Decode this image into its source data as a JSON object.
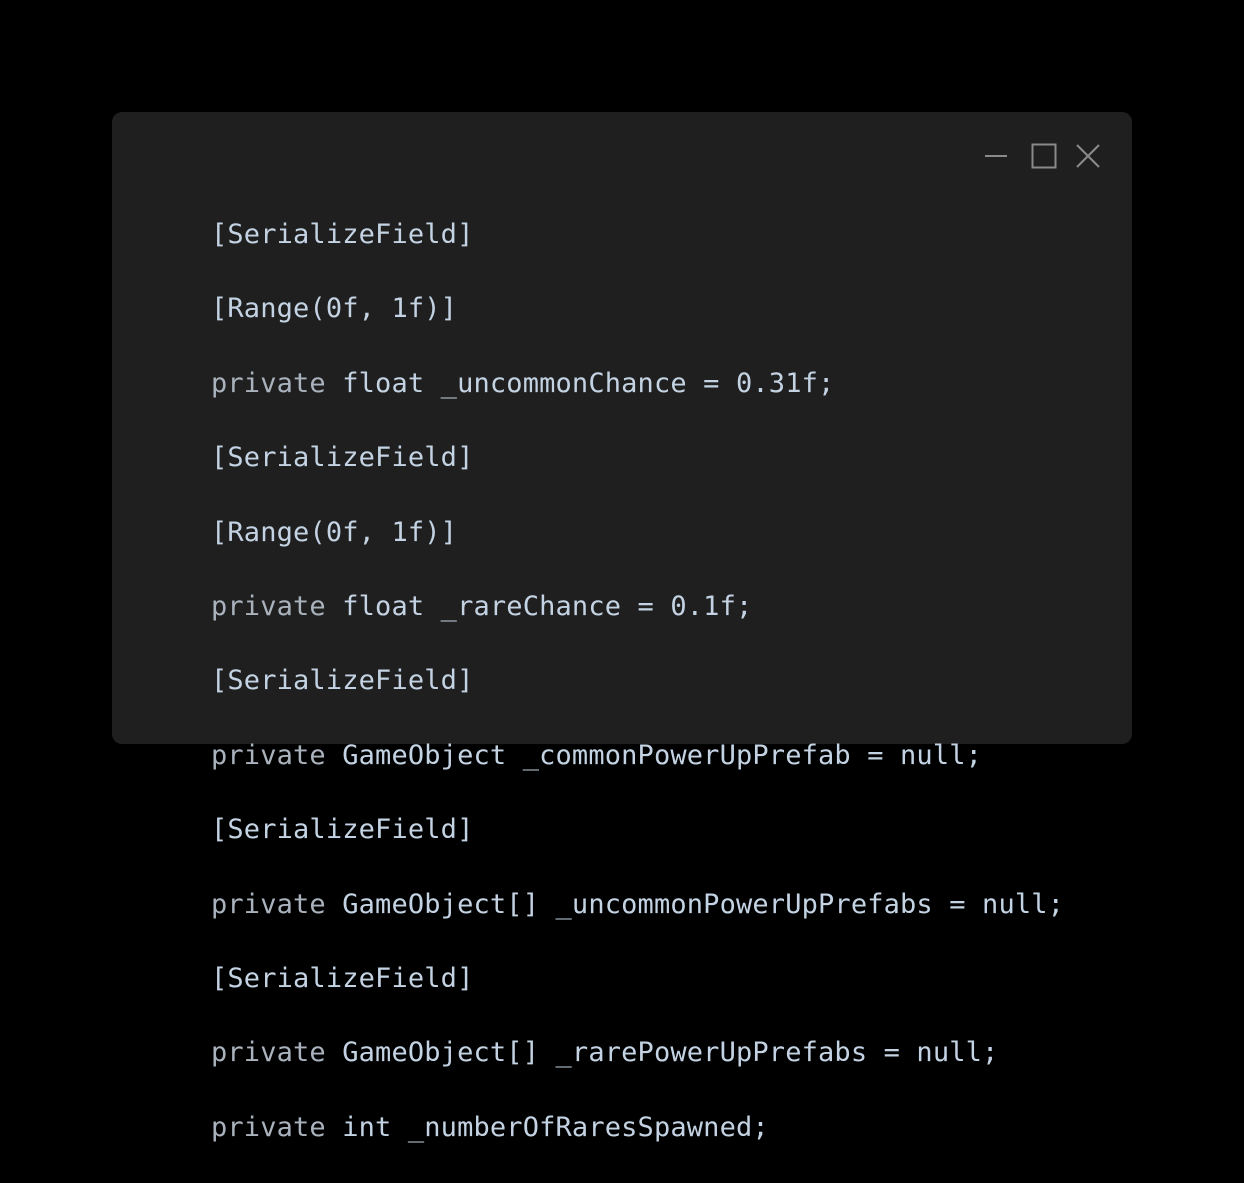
{
  "window": {
    "background": "#1f1f1f",
    "controls": [
      {
        "name": "minimize-icon"
      },
      {
        "name": "maximize-icon"
      },
      {
        "name": "close-icon"
      }
    ]
  },
  "code": {
    "lines": [
      "[SerializeField]",
      "[Range(0f, 1f)]",
      "private float _uncommonChance = 0.31f;",
      "[SerializeField]",
      "[Range(0f, 1f)]",
      "private float _rareChance = 0.1f;",
      "[SerializeField]",
      "private GameObject _commonPowerUpPrefab = null;",
      "[SerializeField]",
      "private GameObject[] _uncommonPowerUpPrefabs = null;",
      "[SerializeField]",
      "private GameObject[] _rarePowerUpPrefabs = null;",
      "private int _numberOfRaresSpawned;"
    ]
  }
}
